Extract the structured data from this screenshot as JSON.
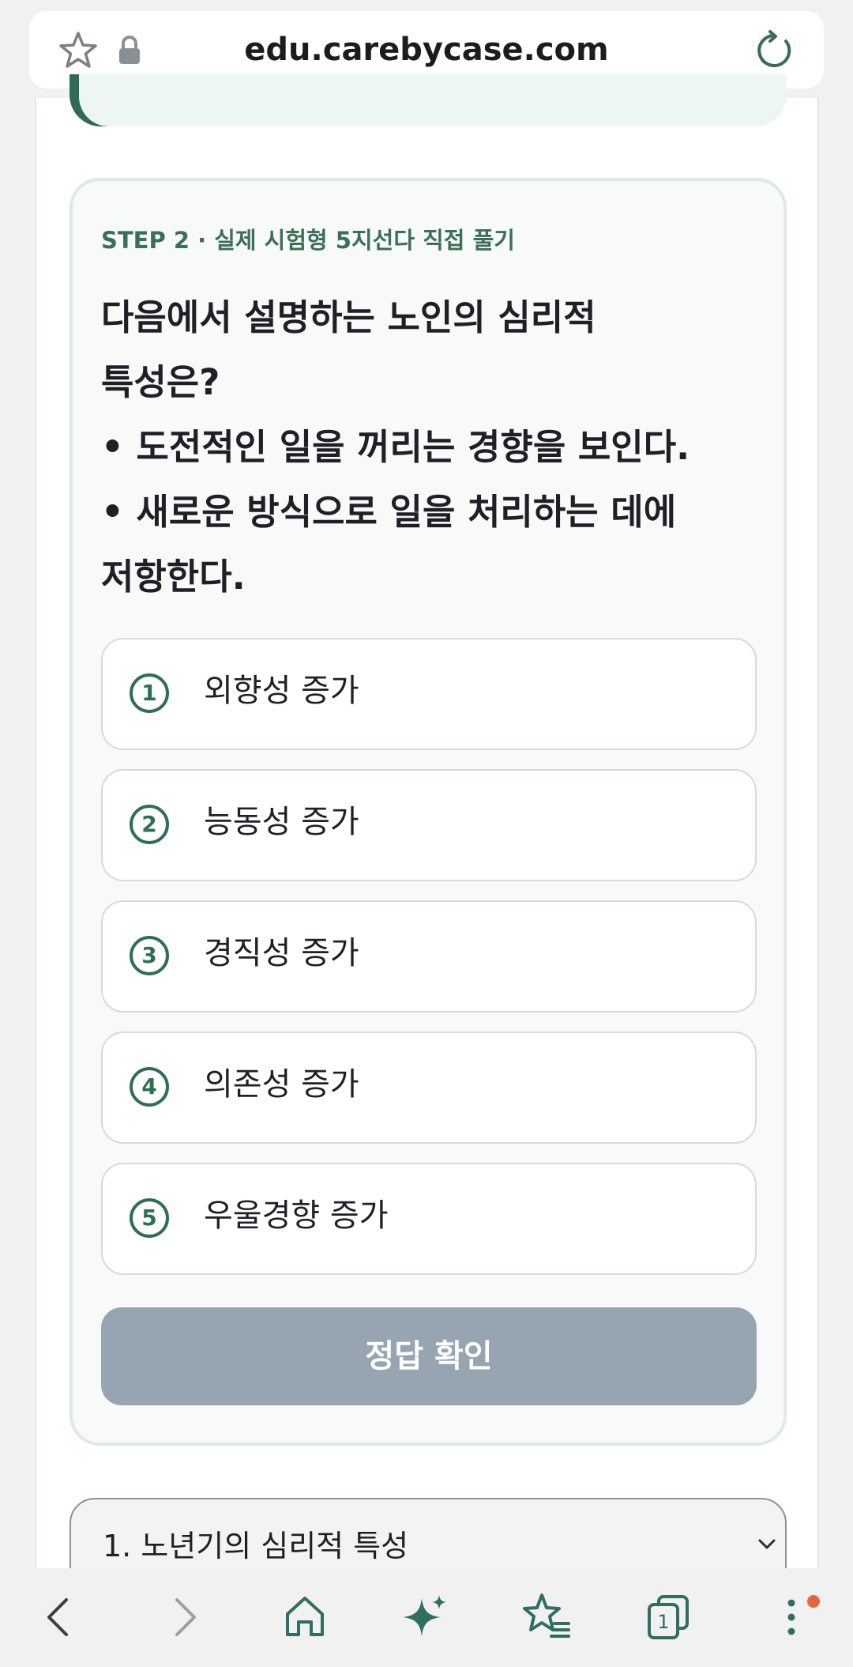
{
  "browser": {
    "url": "edu.carebycase.com"
  },
  "quiz": {
    "step_label": "STEP 2 · 실제 시험형 5지선다 직접 풀기",
    "question_lines": [
      "다음에서 설명하는 노인의 심리적",
      "특성은?",
      " • 도전적인 일을 꺼리는 경향을 보인다.",
      " • 새로운 방식으로 일을 처리하는 데에",
      "저항한다."
    ],
    "options": [
      {
        "num": "1",
        "label": "외향성 증가"
      },
      {
        "num": "2",
        "label": "능동성 증가"
      },
      {
        "num": "3",
        "label": "경직성 증가"
      },
      {
        "num": "4",
        "label": "의존성 증가"
      },
      {
        "num": "5",
        "label": "우울경향 증가"
      }
    ],
    "submit_label": "정답 확인"
  },
  "accordion": {
    "title": "1. 노년기의 심리적 특성"
  },
  "tabs_count": "1",
  "colors": {
    "accent_green": "#2e6e54",
    "button_disabled": "#97a5b2",
    "notification_dot": "#e2673b"
  }
}
